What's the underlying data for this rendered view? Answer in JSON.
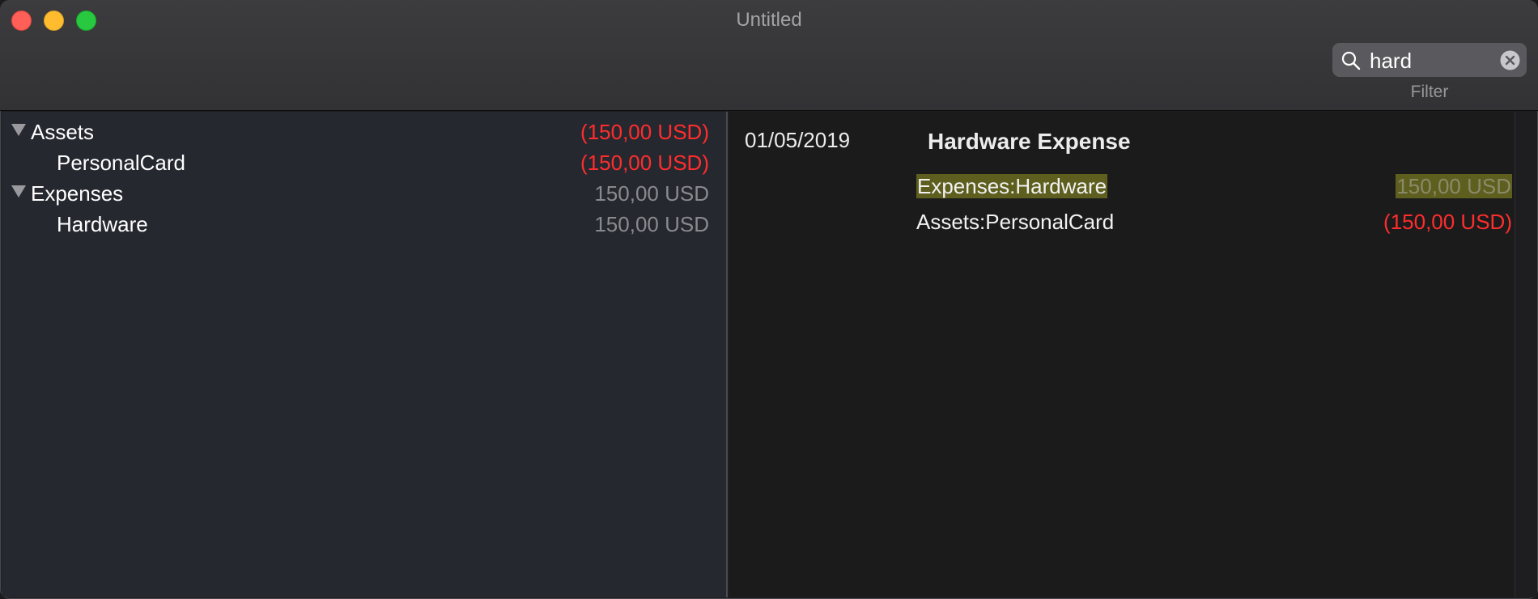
{
  "window": {
    "title": "Untitled"
  },
  "toolbar": {
    "search": {
      "value": "hard",
      "label": "Filter"
    }
  },
  "accounts": [
    {
      "name": "Assets",
      "amount": "(150,00 USD)",
      "amount_color": "#ff2d2d",
      "expanded": true,
      "level": 0
    },
    {
      "name": "PersonalCard",
      "amount": "(150,00 USD)",
      "amount_color": "#ff2d2d",
      "level": 1
    },
    {
      "name": "Expenses",
      "amount": "150,00 USD",
      "amount_color": "#8a8a8e",
      "expanded": true,
      "level": 0
    },
    {
      "name": "Hardware",
      "amount": "150,00 USD",
      "amount_color": "#8a8a8e",
      "level": 1
    }
  ],
  "transaction": {
    "date": "01/05/2019",
    "payee": "Hardware Expense",
    "postings": [
      {
        "account": "Expenses:Hardware",
        "amount": "150,00 USD",
        "amount_color": "#8a8a6a",
        "highlighted": true
      },
      {
        "account": "Assets:PersonalCard",
        "amount": "(150,00 USD)",
        "amount_color": "#ff2d2d",
        "highlighted": false
      }
    ]
  },
  "colors": {
    "negative": "#ff2d2d",
    "highlight": "#5e5f1f",
    "sidebar_bg": "#262830"
  }
}
